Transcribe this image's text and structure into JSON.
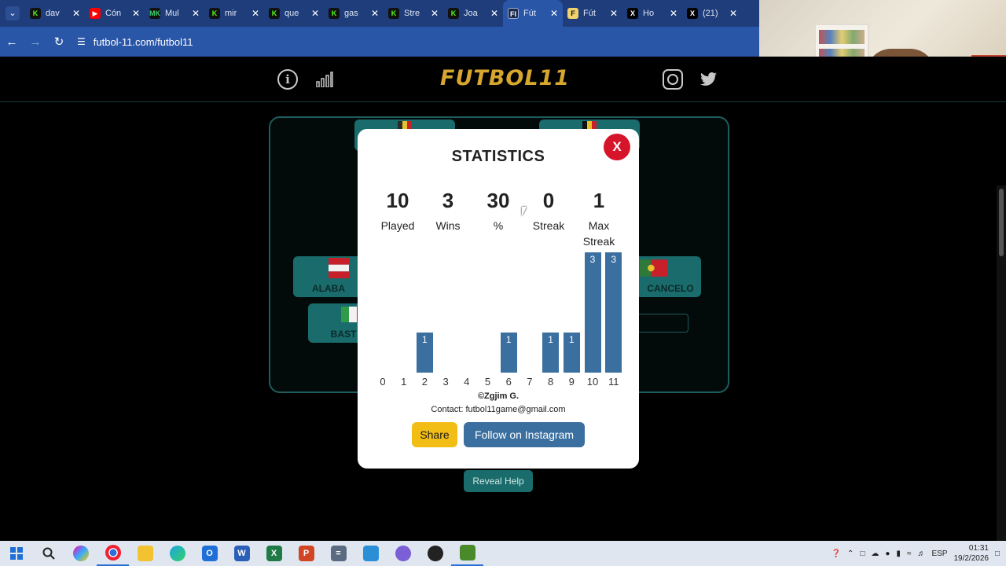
{
  "browser": {
    "tabs": [
      {
        "title": "dav",
        "favicon": "kick-k"
      },
      {
        "title": "Cón",
        "favicon": "youtube"
      },
      {
        "title": "Mul",
        "favicon": "mk"
      },
      {
        "title": "mir",
        "favicon": "kick-k"
      },
      {
        "title": "que",
        "favicon": "kick-k"
      },
      {
        "title": "gas",
        "favicon": "kick-k"
      },
      {
        "title": "Stre",
        "favicon": "kick-k"
      },
      {
        "title": "Joa",
        "favicon": "kick-k"
      },
      {
        "title": "Fút",
        "favicon": "futbol11",
        "active": true
      },
      {
        "title": "Fút",
        "favicon": "futbol-f"
      },
      {
        "title": "Ho",
        "favicon": "x"
      },
      {
        "title": "(21)",
        "favicon": "x"
      }
    ],
    "url": "futbol-11.com/futbol11"
  },
  "site": {
    "logo": "FUTBOL11",
    "reveal_help": "Reveal Help",
    "field_cards": [
      {
        "label": "ALABA",
        "flag": "austria"
      },
      {
        "label": "BAST",
        "flag": "italy"
      },
      {
        "label": "CANCELO",
        "flag": "portugal"
      }
    ]
  },
  "modal": {
    "title": "STATISTICS",
    "close_label": "X",
    "stats": [
      {
        "value": "10",
        "label": "Played"
      },
      {
        "value": "3",
        "label": "Wins"
      },
      {
        "value": "30",
        "label": "%"
      },
      {
        "value": "0",
        "label": "Streak"
      },
      {
        "value": "1",
        "label": "Max Streak"
      }
    ],
    "credit": "©Zgjim G.",
    "contact": "Contact: futbol11game@gmail.com",
    "share_label": "Share",
    "follow_label": "Follow on Instagram"
  },
  "chart_data": {
    "type": "bar",
    "categories": [
      "0",
      "1",
      "2",
      "3",
      "4",
      "5",
      "6",
      "7",
      "8",
      "9",
      "10",
      "11"
    ],
    "values": [
      0,
      0,
      1,
      0,
      0,
      0,
      1,
      0,
      1,
      1,
      3,
      3
    ],
    "bar_color": "#3a6f9f"
  },
  "taskbar": {
    "language": "ESP",
    "time": "01:31",
    "date": "19/2/2026"
  },
  "colors": {
    "accent_gold": "#d7a62f",
    "teal": "#1a6b6b",
    "close_red": "#d6142a",
    "share_yellow": "#f2bd14",
    "chart_blue": "#3a6f9f"
  }
}
